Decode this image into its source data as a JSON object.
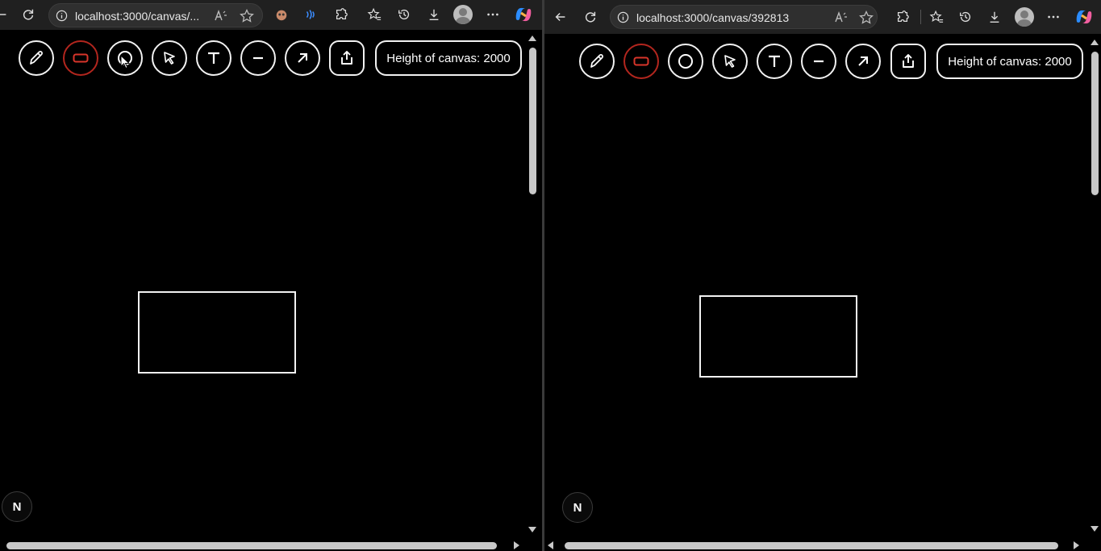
{
  "colors": {
    "canvas_bg": "#000000",
    "browser_bar": "#202020",
    "stroke": "#f2f2f2",
    "active_tool": "#b3261e"
  },
  "toolbar": {
    "tools": [
      {
        "name": "pencil",
        "icon": "pencil-icon",
        "active": false
      },
      {
        "name": "rectangle",
        "icon": "rectangle-icon",
        "active": true
      },
      {
        "name": "circle",
        "icon": "circle-icon",
        "active": false
      },
      {
        "name": "select",
        "icon": "pointer-icon",
        "active": false
      },
      {
        "name": "text",
        "icon": "text-icon",
        "active": false
      },
      {
        "name": "line",
        "icon": "line-icon",
        "active": false
      },
      {
        "name": "arrow",
        "icon": "arrow-icon",
        "active": false
      },
      {
        "name": "share",
        "icon": "share-icon",
        "active": false
      }
    ],
    "height_label": "Height of canvas: 2000"
  },
  "left_window": {
    "url": "localhost:3000/canvas/..."
  },
  "right_window": {
    "url": "localhost:3000/canvas/392813"
  },
  "badge": {
    "letter": "N"
  }
}
